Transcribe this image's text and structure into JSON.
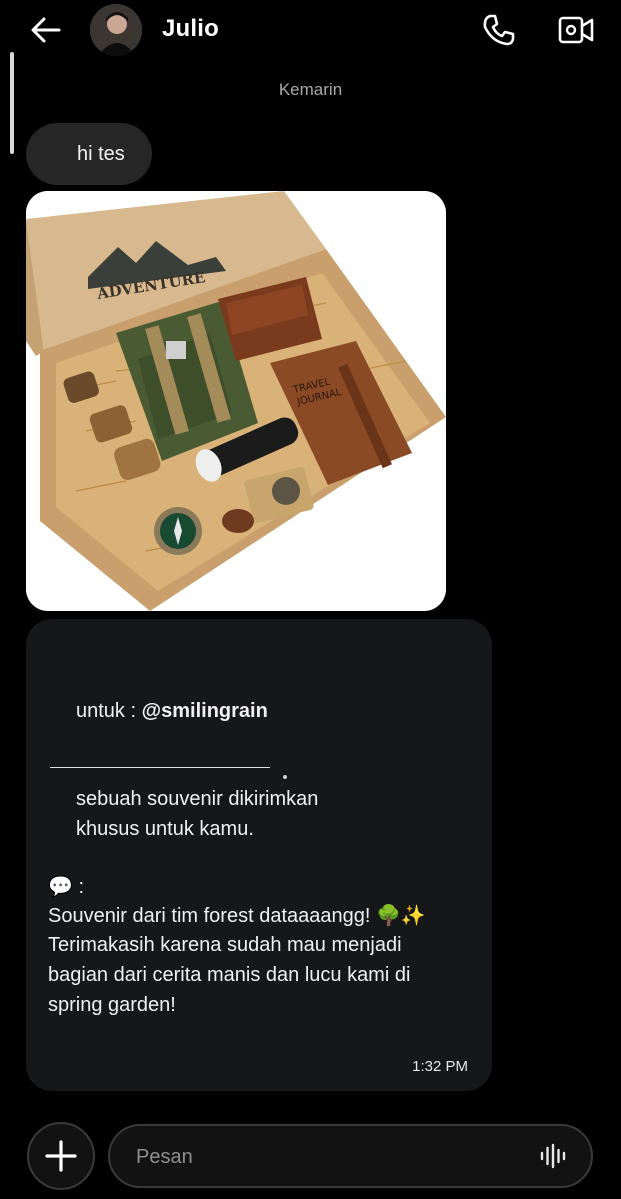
{
  "header": {
    "contact_name": "Julio",
    "back_icon": "arrow-left-icon",
    "call_icon": "phone-icon",
    "video_icon": "video-camera-icon"
  },
  "conversation": {
    "date_separator": "Kemarin",
    "messages": [
      {
        "type": "text",
        "text": "hi tes"
      },
      {
        "type": "image",
        "box_label": "ADVENTURE",
        "journal_label_1": "TRAVEL",
        "journal_label_2": "JOURNAL"
      },
      {
        "type": "card",
        "to_prefix": "untuk : ",
        "to_handle": "@smilingrain",
        "line1": "sebuah souvenir dikirimkan",
        "line2": "khusus untuk kamu.",
        "speech_emoji": "💬",
        "speech_suffix": " :",
        "body1": "Souvenir dari tim forest dataaaangg! 🌳✨",
        "body2": "Terimakasih karena sudah mau menjadi",
        "body3": "bagian dari cerita manis dan lucu kami di",
        "body4": "spring garden!",
        "time": "1:32 PM"
      }
    ]
  },
  "composer": {
    "placeholder": "Pesan",
    "add_icon": "plus-icon",
    "voice_icon": "voice-wave-icon"
  },
  "colors": {
    "background": "#000000",
    "incoming_bubble": "#262626",
    "card_bubble": "#161719",
    "muted_text": "#a8a8a8"
  }
}
